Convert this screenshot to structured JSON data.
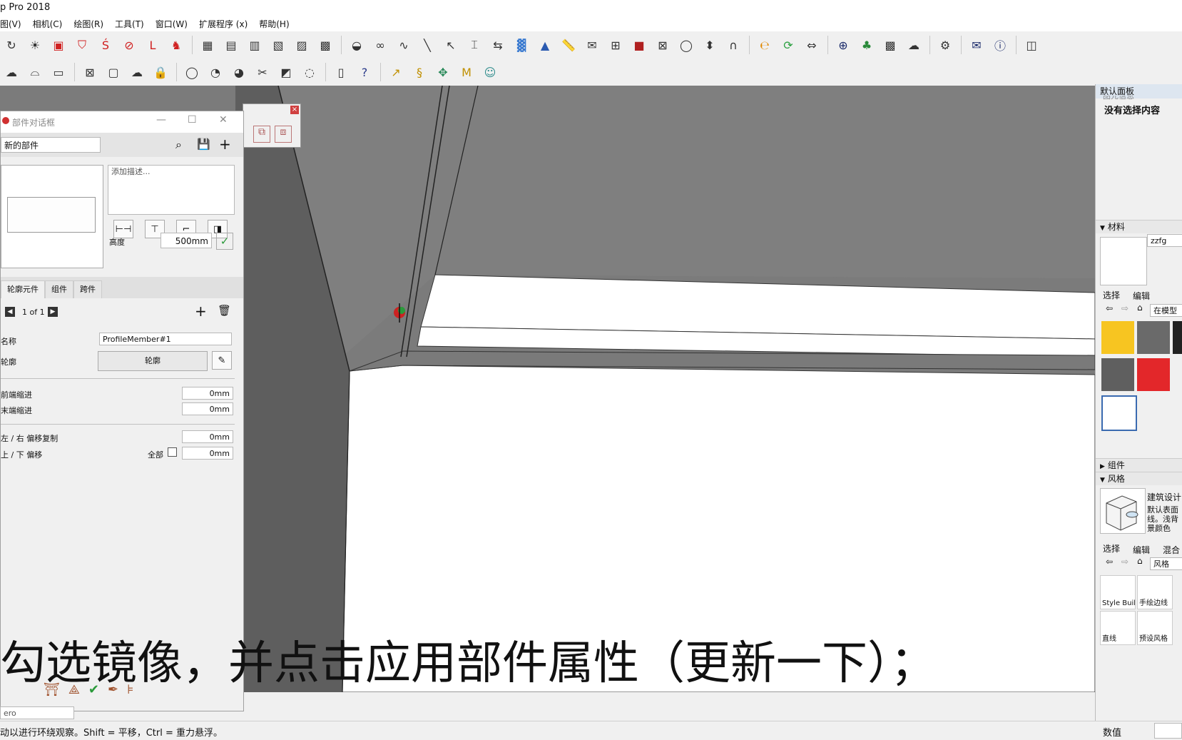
{
  "window": {
    "title": "p Pro 2018"
  },
  "menu": [
    "图(V)",
    "相机(C)",
    "绘图(R)",
    "工具(T)",
    "窗口(W)",
    "扩展程序 (x)",
    "帮助(H)"
  ],
  "toolbar1_icons": [
    "orbit-icon",
    "light-icon",
    "rbc-icon",
    "shield-icon",
    "s-icon",
    "no-icon",
    "l-icon",
    "elephant-icon",
    "boxes-icon",
    "box1-icon",
    "box2-icon",
    "box3-icon",
    "box4-icon",
    "box5-icon",
    "shell-icon",
    "loop-icon",
    "curve-icon",
    "line-icon",
    "cursor-icon",
    "dimension-icon",
    "arrow-icon",
    "gradient-icon",
    "s4u-icon",
    "ruler-icon",
    "envelope-icon",
    "grid-icon",
    "cube-icon",
    "window-icon",
    "sphere-icon",
    "push-icon",
    "wave-icon",
    "e-icon",
    "refresh-icon",
    "move-icon",
    "plus-icon",
    "tree-icon",
    "checker-icon",
    "cloud-icon",
    "gear-icon",
    "mail-icon",
    "info-icon",
    "box-icon"
  ],
  "toolbar2_icons": [
    "cloud-icon",
    "hat-icon",
    "frame-icon",
    "window-icon",
    "photo-icon",
    "cloud2-icon",
    "lock-icon",
    "sphere-icon",
    "add-sphere-icon",
    "del-sphere-icon",
    "cut-icon",
    "layer-icon",
    "fog-icon",
    "pillar-icon",
    "help-icon",
    "pick-icon",
    "s-curve-icon",
    "move-arrows-icon",
    "m-icon",
    "person-icon"
  ],
  "dialog": {
    "title": "部件对话框",
    "name_value": "新的部件",
    "description_placeholder": "添加描述...",
    "height_label": "高度",
    "height_value": "500mm",
    "tabs": [
      "轮廓元件",
      "组件",
      "跨件"
    ],
    "pager": "1 of 1",
    "name_label": "名称",
    "name_field": "ProfileMember#1",
    "profile_label": "轮廓",
    "profile_button": "轮廓",
    "start_offset_label": "前端缩进",
    "start_offset_value": "0mm",
    "end_offset_label": "末端缩进",
    "end_offset_value": "0mm",
    "lr_label": "左 / 右 偏移复制",
    "lr_value": "0mm",
    "ud_label": "上 / 下 偏移",
    "all_label": "全部",
    "ud_value": "0mm"
  },
  "tray": {
    "title": "默认面板",
    "partial_header": "图元信息",
    "no_selection": "没有选择内容",
    "materials_header": "材料",
    "material_name": "zzfg",
    "select_tab": "选择",
    "edit_tab": "编辑",
    "mix_tab": "混合",
    "in_model": "在模型",
    "components_header": "组件",
    "styles_header": "风格",
    "style_name": "建筑设计",
    "style_desc": "默认表面线。浅背景颜色",
    "style_dropdown": "风格",
    "style_thumbs": [
      "Style Buil",
      "手绘边线",
      "直线",
      "预设风格"
    ],
    "swatch_colors": [
      "#f7c521",
      "#6a6a6a",
      "#222222",
      "#5f5f5f",
      "#e3272a",
      "#ffffff"
    ]
  },
  "subtitle": "勾选镜像，并点击应用部件属性（更新一下）；",
  "status": {
    "hint": "动以进行环绕观察。Shift = 平移，Ctrl = 重力悬浮。",
    "value_label": "数值",
    "left_field": "ero"
  }
}
